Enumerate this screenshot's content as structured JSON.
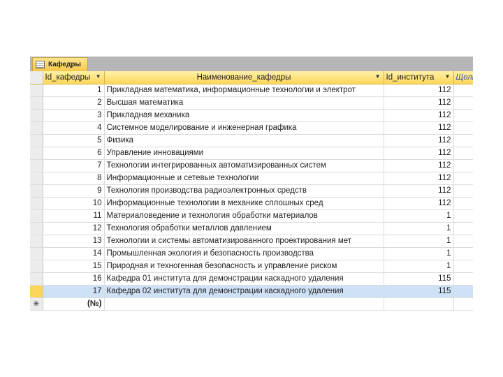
{
  "tab": {
    "title": "Кафедры",
    "icon": "table-icon"
  },
  "columns": [
    "Id_кафедры",
    "Наименование_кафедры",
    "Id_института",
    "Щелк"
  ],
  "rows": [
    {
      "id": "1",
      "name": "Прикладная математика, информационные технологии и электрот",
      "inst": "112"
    },
    {
      "id": "2",
      "name": "Высшая математика",
      "inst": "112"
    },
    {
      "id": "3",
      "name": "Прикладная механика",
      "inst": "112"
    },
    {
      "id": "4",
      "name": "Системное моделирование и инженерная графика",
      "inst": "112"
    },
    {
      "id": "5",
      "name": "Физика",
      "inst": "112"
    },
    {
      "id": "6",
      "name": "Управление инновациями",
      "inst": "112"
    },
    {
      "id": "7",
      "name": "Технологии интегрированных автоматизированных систем",
      "inst": "112"
    },
    {
      "id": "8",
      "name": "Информационные и сетевые технологии",
      "inst": "112"
    },
    {
      "id": "9",
      "name": "Технология производства радиоэлектронных средств",
      "inst": "112"
    },
    {
      "id": "10",
      "name": "Информационные технологии в механике сплошных сред",
      "inst": "112"
    },
    {
      "id": "11",
      "name": "Материаловедение и технология обработки материалов",
      "inst": "1"
    },
    {
      "id": "12",
      "name": "Технология обработки металлов давлением",
      "inst": "1"
    },
    {
      "id": "13",
      "name": "Технологии и системы автоматизированного проектирования мет",
      "inst": "1"
    },
    {
      "id": "14",
      "name": "Промышленная экология и безопасность производства",
      "inst": "1"
    },
    {
      "id": "15",
      "name": "Природная и техногенная безопасность и управление риском",
      "inst": "1"
    },
    {
      "id": "16",
      "name": "Кафедра 01 института для демонстрации каскадного удаления",
      "inst": "115"
    },
    {
      "id": "17",
      "name": "Кафедра 02 института для демонстрации каскадного удаления",
      "inst": "115"
    }
  ],
  "new_row": {
    "marker": "✳",
    "id": "(№)"
  },
  "selected_row": "17",
  "colors": {
    "header_gold": "#fbd65a",
    "selected_row": "#cfe1f6"
  }
}
